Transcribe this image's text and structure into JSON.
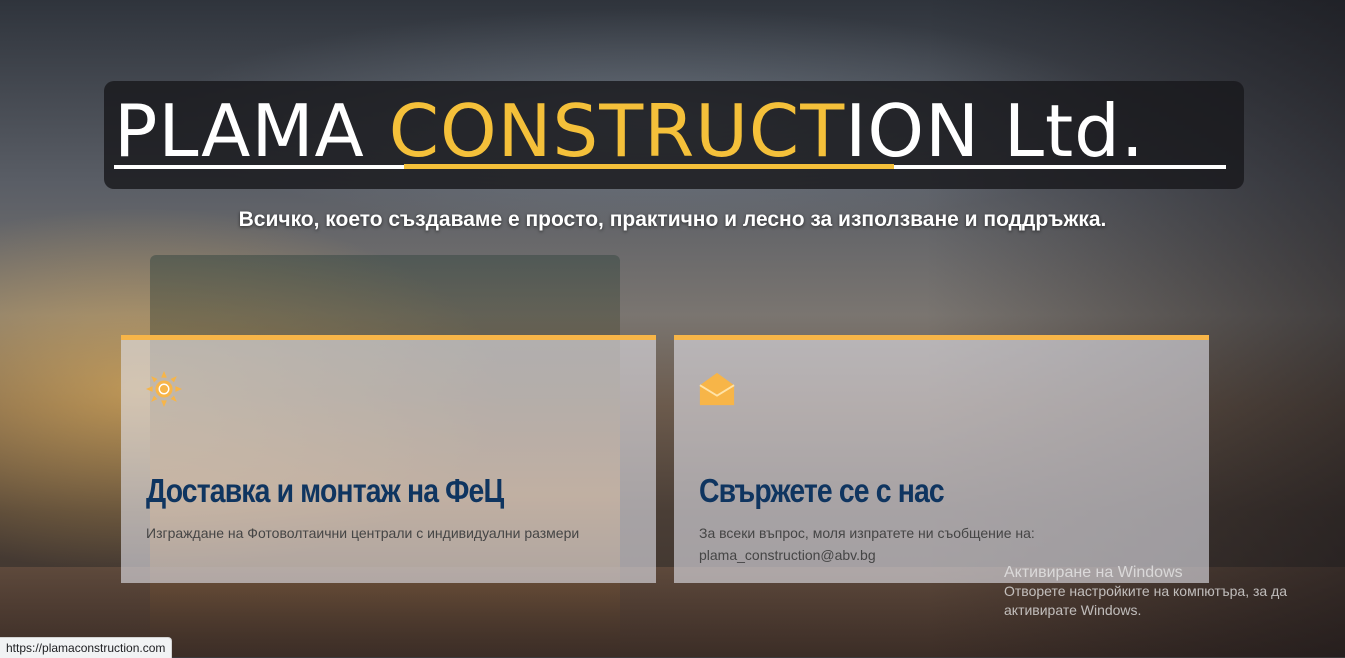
{
  "logo": {
    "part1": "PLAMA ",
    "part2": "CONSTRUCT",
    "part3": "ION Ltd.",
    "accent_color": "#f4c03a"
  },
  "tagline": "Всичко, което създаваме е просто, практично и лесно за използване и поддръжка.",
  "cards": [
    {
      "icon": "sun-icon",
      "title": "Доставка и монтаж на ФеЦ",
      "text": "Изграждане на Фотоволтаични централи с индивидуални размери"
    },
    {
      "icon": "envelope-icon",
      "title": "Свържете се с нас",
      "text": "За всеки въпрос, моля изпратете ни съобщение на:",
      "email": "plama_construction@abv.bg"
    }
  ],
  "card_accent_color": "#f7b548",
  "title_color": "#0f3560",
  "windows_notice": {
    "title": "Активиране на Windows",
    "text": "Отворете настройките на компютъра, за да активирате Windows."
  },
  "status_url": "https://plamaconstruction.com"
}
